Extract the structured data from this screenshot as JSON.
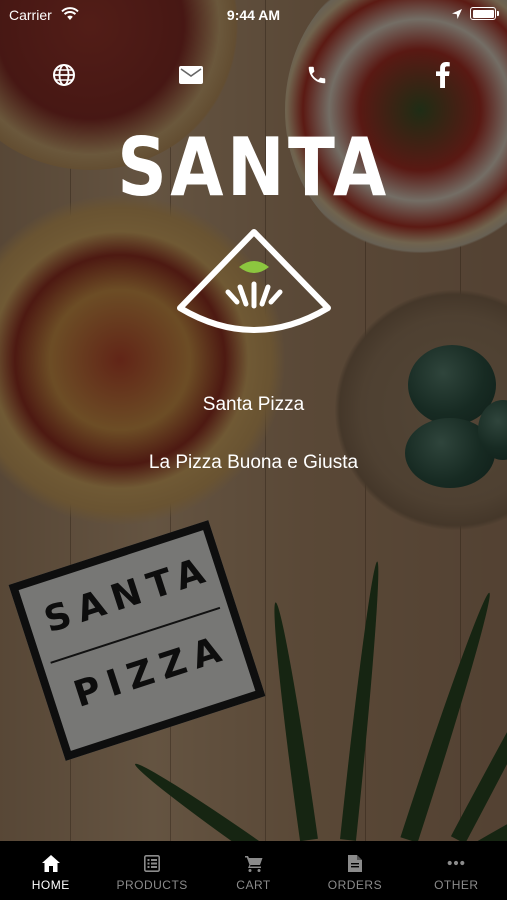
{
  "status_bar": {
    "carrier": "Carrier",
    "time": "9:44 AM"
  },
  "contact": {
    "icons": [
      "globe-icon",
      "mail-icon",
      "phone-icon",
      "facebook-icon"
    ]
  },
  "brand": {
    "title": "SANTA",
    "logo_accent_color": "#8cc63f",
    "store_name": "Santa Pizza",
    "tagline": "La Pizza Buona e Giusta"
  },
  "background_sign": {
    "line1": "SANTA",
    "line2": "PIZZA"
  },
  "tabbar": {
    "active": "home",
    "tabs": [
      {
        "id": "home",
        "label": "HOME",
        "icon": "home-icon"
      },
      {
        "id": "products",
        "label": "PRODUCTS",
        "icon": "list-icon"
      },
      {
        "id": "cart",
        "label": "CART",
        "icon": "cart-icon"
      },
      {
        "id": "orders",
        "label": "ORDERS",
        "icon": "document-icon"
      },
      {
        "id": "other",
        "label": "OTHER",
        "icon": "more-icon"
      }
    ]
  },
  "colors": {
    "tabbar_background": "#000000",
    "tab_active": "#ffffff",
    "tab_inactive": "#8b8b8b"
  }
}
